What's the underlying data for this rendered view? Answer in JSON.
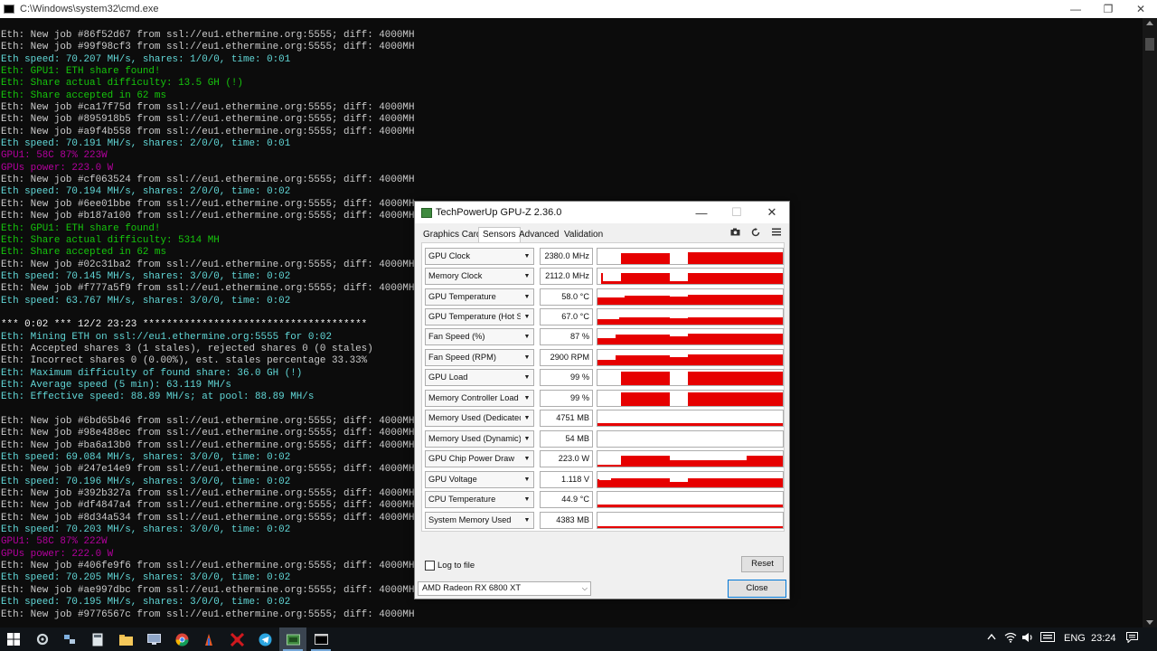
{
  "cmd": {
    "title": "C:\\Windows\\system32\\cmd.exe",
    "lines": [
      {
        "t": "Eth: New job #86f52d67 from ssl://eu1.ethermine.org:5555; diff: 4000MH",
        "c": "#cccccc"
      },
      {
        "t": "Eth: New job #99f98cf3 from ssl://eu1.ethermine.org:5555; diff: 4000MH",
        "c": "#cccccc"
      },
      {
        "t": "Eth speed: 70.207 MH/s, shares: 1/0/0, time: 0:01",
        "c": "#61d6d6"
      },
      {
        "t": "Eth: GPU1: ETH share found!",
        "c": "#16c60c"
      },
      {
        "t": "Eth: Share actual difficulty: 13.5 GH (!)",
        "c": "#16c60c"
      },
      {
        "t": "Eth: Share accepted in 62 ms",
        "c": "#16c60c"
      },
      {
        "t": "Eth: New job #ca17f75d from ssl://eu1.ethermine.org:5555; diff: 4000MH",
        "c": "#cccccc"
      },
      {
        "t": "Eth: New job #895918b5 from ssl://eu1.ethermine.org:5555; diff: 4000MH",
        "c": "#cccccc"
      },
      {
        "t": "Eth: New job #a9f4b558 from ssl://eu1.ethermine.org:5555; diff: 4000MH",
        "c": "#cccccc"
      },
      {
        "t": "Eth speed: 70.191 MH/s, shares: 2/0/0, time: 0:01",
        "c": "#61d6d6"
      },
      {
        "t": "GPU1: 58C 87% 223W",
        "c": "#b4009e"
      },
      {
        "t": "GPUs power: 223.0 W",
        "c": "#b4009e"
      },
      {
        "t": "Eth: New job #cf063524 from ssl://eu1.ethermine.org:5555; diff: 4000MH",
        "c": "#cccccc"
      },
      {
        "t": "Eth speed: 70.194 MH/s, shares: 2/0/0, time: 0:02",
        "c": "#61d6d6"
      },
      {
        "t": "Eth: New job #6ee01bbe from ssl://eu1.ethermine.org:5555; diff: 4000MH",
        "c": "#cccccc"
      },
      {
        "t": "Eth: New job #b187a100 from ssl://eu1.ethermine.org:5555; diff: 4000MH",
        "c": "#cccccc"
      },
      {
        "t": "Eth: GPU1: ETH share found!",
        "c": "#16c60c"
      },
      {
        "t": "Eth: Share actual difficulty: 5314 MH",
        "c": "#16c60c"
      },
      {
        "t": "Eth: Share accepted in 62 ms",
        "c": "#16c60c"
      },
      {
        "t": "Eth: New job #02c31ba2 from ssl://eu1.ethermine.org:5555; diff: 4000MH",
        "c": "#cccccc"
      },
      {
        "t": "Eth speed: 70.145 MH/s, shares: 3/0/0, time: 0:02",
        "c": "#61d6d6"
      },
      {
        "t": "Eth: New job #f777a5f9 from ssl://eu1.ethermine.org:5555; diff: 4000MH",
        "c": "#cccccc"
      },
      {
        "t": "Eth speed: 63.767 MH/s, shares: 3/0/0, time: 0:02",
        "c": "#61d6d6"
      },
      {
        "t": "",
        "c": "#cccccc"
      },
      {
        "t": "*** 0:02 *** 12/2 23:23 **************************************",
        "c": "#f2f2f2"
      },
      {
        "t": "Eth: Mining ETH on ssl://eu1.ethermine.org:5555 for 0:02",
        "c": "#61d6d6"
      },
      {
        "t": "Eth: Accepted shares 3 (1 stales), rejected shares 0 (0 stales)",
        "c": "#cccccc"
      },
      {
        "t": "Eth: Incorrect shares 0 (0.00%), est. stales percentage 33.33%",
        "c": "#cccccc"
      },
      {
        "t": "Eth: Maximum difficulty of found share: 36.0 GH (!)",
        "c": "#61d6d6"
      },
      {
        "t": "Eth: Average speed (5 min): 63.119 MH/s",
        "c": "#61d6d6"
      },
      {
        "t": "Eth: Effective speed: 88.89 MH/s; at pool: 88.89 MH/s",
        "c": "#61d6d6"
      },
      {
        "t": "",
        "c": "#cccccc"
      },
      {
        "t": "Eth: New job #6bd65b46 from ssl://eu1.ethermine.org:5555; diff: 4000MH",
        "c": "#cccccc"
      },
      {
        "t": "Eth: New job #98e488ec from ssl://eu1.ethermine.org:5555; diff: 4000MH",
        "c": "#cccccc"
      },
      {
        "t": "Eth: New job #ba6a13b0 from ssl://eu1.ethermine.org:5555; diff: 4000MH",
        "c": "#cccccc"
      },
      {
        "t": "Eth speed: 69.084 MH/s, shares: 3/0/0, time: 0:02",
        "c": "#61d6d6"
      },
      {
        "t": "Eth: New job #247e14e9 from ssl://eu1.ethermine.org:5555; diff: 4000MH",
        "c": "#cccccc"
      },
      {
        "t": "Eth speed: 70.196 MH/s, shares: 3/0/0, time: 0:02",
        "c": "#61d6d6"
      },
      {
        "t": "Eth: New job #392b327a from ssl://eu1.ethermine.org:5555; diff: 4000MH",
        "c": "#cccccc"
      },
      {
        "t": "Eth: New job #df4847a4 from ssl://eu1.ethermine.org:5555; diff: 4000MH",
        "c": "#cccccc"
      },
      {
        "t": "Eth: New job #8d34a534 from ssl://eu1.ethermine.org:5555; diff: 4000MH",
        "c": "#cccccc"
      },
      {
        "t": "Eth speed: 70.203 MH/s, shares: 3/0/0, time: 0:02",
        "c": "#61d6d6"
      },
      {
        "t": "GPU1: 58C 87% 222W",
        "c": "#b4009e"
      },
      {
        "t": "GPUs power: 222.0 W",
        "c": "#b4009e"
      },
      {
        "t": "Eth: New job #406fe9f6 from ssl://eu1.ethermine.org:5555; diff: 4000MH",
        "c": "#cccccc"
      },
      {
        "t": "Eth speed: 70.205 MH/s, shares: 3/0/0, time: 0:02",
        "c": "#61d6d6"
      },
      {
        "t": "Eth: New job #ae997dbc from ssl://eu1.ethermine.org:5555; diff: 4000MH",
        "c": "#cccccc"
      },
      {
        "t": "Eth speed: 70.195 MH/s, shares: 3/0/0, time: 0:02",
        "c": "#61d6d6"
      },
      {
        "t": "Eth: New job #9776567c from ssl://eu1.ethermine.org:5555; diff: 4000MH",
        "c": "#cccccc"
      }
    ]
  },
  "gpuz": {
    "title": "TechPowerUp GPU-Z 2.36.0",
    "tabs": [
      "Graphics Card",
      "Sensors",
      "Advanced",
      "Validation"
    ],
    "active_tab": "Sensors",
    "sensors": [
      {
        "name": "GPU Clock",
        "value": "2380.0 MHz"
      },
      {
        "name": "Memory Clock",
        "value": "2112.0 MHz"
      },
      {
        "name": "GPU Temperature",
        "value": "58.0 °C"
      },
      {
        "name": "GPU Temperature (Hot Spot)",
        "value": "67.0 °C"
      },
      {
        "name": "Fan Speed (%)",
        "value": "87 %"
      },
      {
        "name": "Fan Speed (RPM)",
        "value": "2900 RPM"
      },
      {
        "name": "GPU Load",
        "value": "99 %"
      },
      {
        "name": "Memory Controller Load",
        "value": "99 %"
      },
      {
        "name": "Memory Used (Dedicated)",
        "value": "4751 MB"
      },
      {
        "name": "Memory Used (Dynamic)",
        "value": "54 MB"
      },
      {
        "name": "GPU Chip Power Draw",
        "value": "223.0 W"
      },
      {
        "name": "GPU Voltage",
        "value": "1.118 V"
      },
      {
        "name": "CPU Temperature",
        "value": "44.9 °C"
      },
      {
        "name": "System Memory Used",
        "value": "4383 MB"
      }
    ],
    "log_to_file_label": "Log to file",
    "reset_label": "Reset",
    "gpu_selected": "AMD Radeon RX 6800 XT",
    "close_label": "Close",
    "graph_color": "#e60000"
  },
  "taskbar": {
    "language": "ENG",
    "time": "23:24"
  }
}
